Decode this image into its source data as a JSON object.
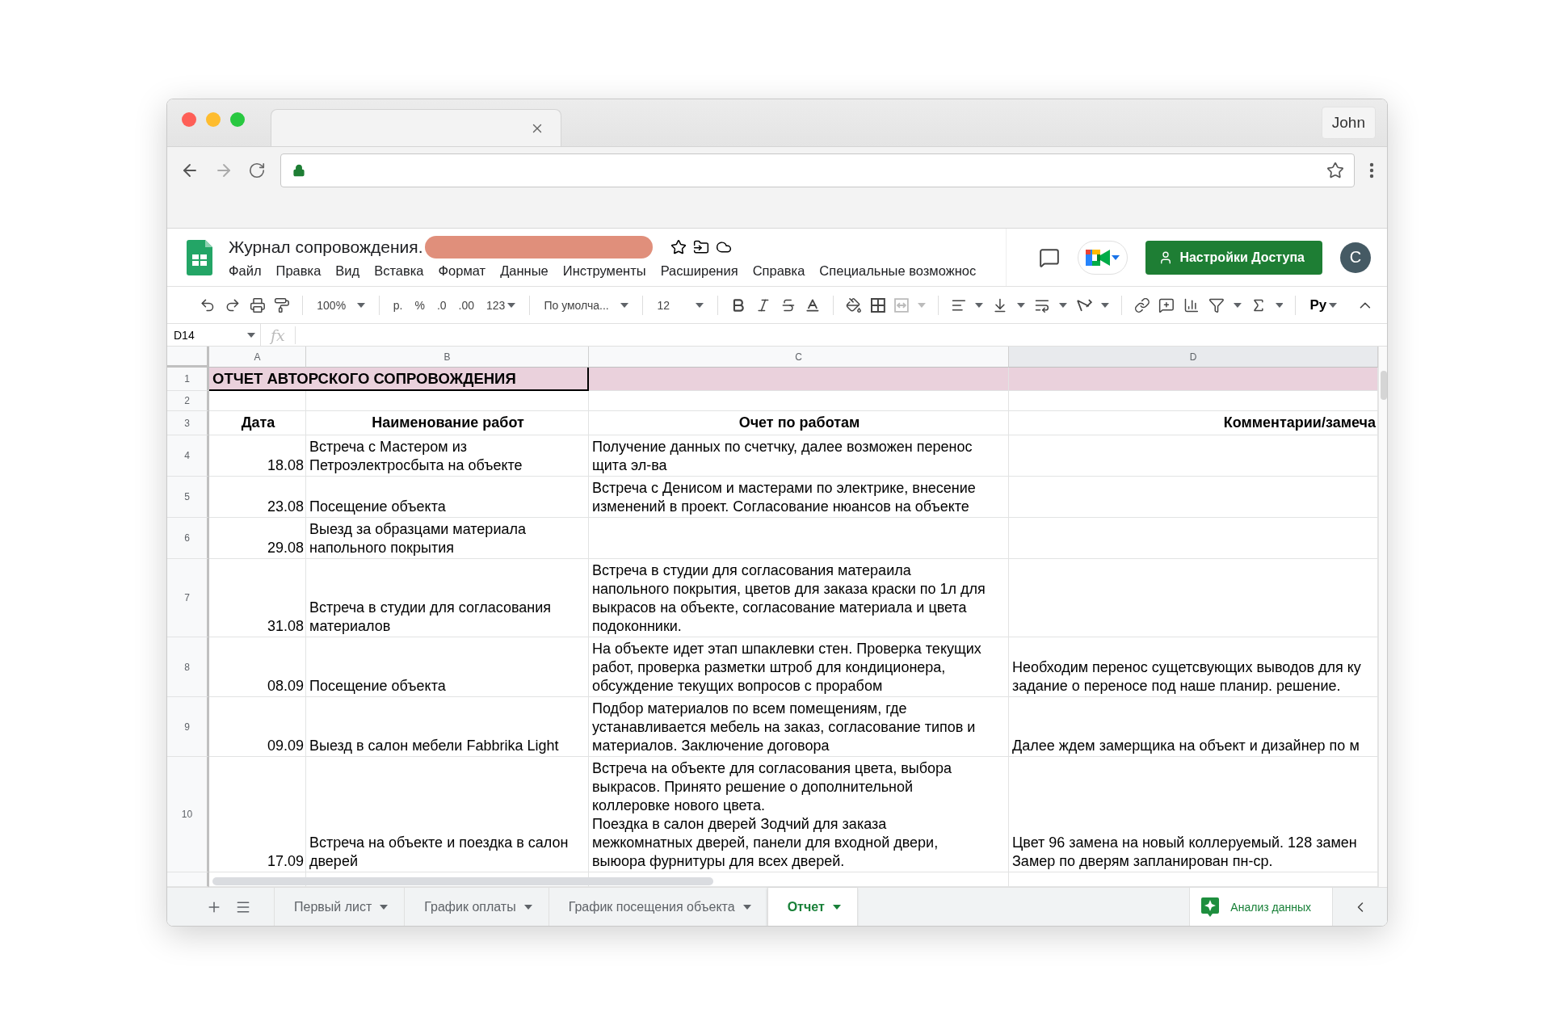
{
  "browser": {
    "profile": "John"
  },
  "app": {
    "title": "Журнал сопровождения.",
    "menu": [
      "Файл",
      "Правка",
      "Вид",
      "Вставка",
      "Формат",
      "Данные",
      "Инструменты",
      "Расширения",
      "Справка",
      "Специальные возможнос"
    ],
    "share_button": "Настройки Доступа",
    "avatar": "C"
  },
  "toolbar": {
    "zoom": "100%",
    "currency": "р.",
    "percent": "%",
    "decrease_decimals": ".0",
    "increase_decimals": ".00",
    "number_format": "123",
    "font": "По умолча...",
    "font_size": "12",
    "input_tools": "Ру"
  },
  "formula_bar": {
    "cell": "D14",
    "fx": "fx"
  },
  "grid": {
    "columns": [
      {
        "label": "A",
        "selected": false
      },
      {
        "label": "B",
        "selected": false
      },
      {
        "label": "C",
        "selected": false
      },
      {
        "label": "D",
        "selected": true
      }
    ],
    "rows": [
      {
        "number": "1",
        "kind": "title",
        "cells": [
          "ОТЧЕТ АВТОРСКОГО СОПРОВОЖДЕНИЯ"
        ]
      },
      {
        "number": "2",
        "kind": "blank",
        "cells": []
      },
      {
        "number": "3",
        "kind": "header",
        "cells": [
          "Дата",
          "Наименование работ",
          "Очет по работам",
          "Комментарии/замеча"
        ]
      },
      {
        "number": "4",
        "kind": "data",
        "cells": [
          "18.08",
          "Встреча с Мастером из\nПетроэлектросбыта на объекте",
          "Получение данных по счетчку, далее возможен перенос\nщита эл-ва",
          ""
        ]
      },
      {
        "number": "5",
        "kind": "data",
        "cells": [
          "23.08",
          "Посещение объекта",
          "Встреча с Денисом и мастерами по электрике, внесение\nизменений в проект. Согласование нюансов на объекте",
          ""
        ]
      },
      {
        "number": "6",
        "kind": "data",
        "cells": [
          "29.08",
          "Выезд за образцами материала\nнапольного покрытия",
          "",
          ""
        ]
      },
      {
        "number": "7",
        "kind": "data",
        "cells": [
          "31.08",
          "Встреча в студии для согласования\nматериалов",
          "Встреча в студии для согласования матераила\nнапольного покрытия, цветов для заказа краски по 1л для\nвыкрасов на объекте, согласование материала и цвета\nподоконники.",
          ""
        ]
      },
      {
        "number": "8",
        "kind": "data",
        "cells": [
          "08.09",
          "Посещение объекта",
          "На объекте идет этап шпаклевки стен. Проверка текущих\nработ, проверка разметки штроб для кондиционера,\nобсуждение текущих вопросов с прорабом",
          "Необходим перенос сущетсвующих выводов для ку\nзадание о переносе под наше планир. решение."
        ]
      },
      {
        "number": "9",
        "kind": "data",
        "cells": [
          "09.09",
          "Выезд в салон мебели Fabbrika Light",
          "Подбор материалов по всем помещениям, где\nустанавливается мебель на заказ, согласование типов и\nматериалов. Заключение договора",
          "Далее ждем замерщика на объект и дизайнер по м"
        ]
      },
      {
        "number": "10",
        "kind": "data",
        "cells": [
          "17.09",
          "Встреча на объекте и поездка в салон\nдверей",
          "Встреча на объекте для согласования цвета, выбора\nвыкрасов. Принято решение о дополнительной\nколлеровке нового цвета.\nПоездка в салон дверей Зодчий для заказа\nмежкомнатных дверей, панели для входной двери,\nвыюора фурнитуры для всех дверей.",
          "Цвет 96 замена на новый коллеруемый. 128 замен\nЗамер по дверям запланирован пн-ср."
        ]
      }
    ]
  },
  "sheet_tabs": [
    {
      "label": "Первый лист",
      "selected": false
    },
    {
      "label": "График оплаты",
      "selected": false
    },
    {
      "label": "График посещения объекта",
      "selected": false
    },
    {
      "label": "Отчет",
      "selected": true
    }
  ],
  "explore_button": "Анализ данных"
}
